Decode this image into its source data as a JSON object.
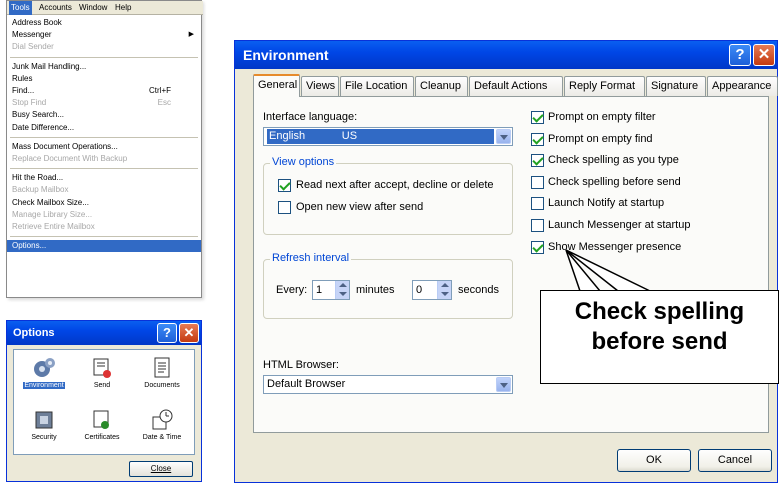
{
  "tools_menu": {
    "menubar": [
      "Tools",
      "Accounts",
      "Window",
      "Help"
    ],
    "items": [
      {
        "label": "Address Book",
        "disabled": false
      },
      {
        "label": "Messenger",
        "disabled": false,
        "submenu": true
      },
      {
        "label": "Dial Sender",
        "disabled": true
      },
      {
        "sep": true
      },
      {
        "label": "Junk Mail Handling...",
        "disabled": false
      },
      {
        "label": "Rules",
        "disabled": false
      },
      {
        "label": "Find...",
        "shortcut": "Ctrl+F",
        "disabled": false
      },
      {
        "label": "Stop Find",
        "shortcut": "Esc",
        "disabled": true
      },
      {
        "label": "Busy Search...",
        "disabled": false
      },
      {
        "label": "Date Difference...",
        "disabled": false
      },
      {
        "sep": true
      },
      {
        "label": "Mass Document Operations...",
        "disabled": false
      },
      {
        "label": "Replace Document With Backup",
        "disabled": true
      },
      {
        "sep": true
      },
      {
        "label": "Hit the Road...",
        "disabled": false
      },
      {
        "label": "Backup Mailbox",
        "disabled": true
      },
      {
        "label": "Check Mailbox Size...",
        "disabled": false
      },
      {
        "label": "Manage Library Size...",
        "disabled": true
      },
      {
        "label": "Retrieve Entire Mailbox",
        "disabled": true
      },
      {
        "sep": true
      },
      {
        "label": "Options...",
        "disabled": false,
        "highlighted": true
      }
    ]
  },
  "options_dialog": {
    "title": "Options",
    "help": "?",
    "close": "✕",
    "icons": [
      {
        "label": "Environment",
        "selected": true,
        "icon": "environment-icon"
      },
      {
        "label": "Send",
        "selected": false,
        "icon": "send-icon"
      },
      {
        "label": "Documents",
        "selected": false,
        "icon": "documents-icon"
      },
      {
        "label": "Security",
        "selected": false,
        "icon": "security-icon"
      },
      {
        "label": "Certificates",
        "selected": false,
        "icon": "certificates-icon"
      },
      {
        "label": "Date & Time",
        "selected": false,
        "icon": "date-time-icon"
      }
    ],
    "close_button": "Close"
  },
  "environment_dialog": {
    "title": "Environment",
    "help": "?",
    "close": "✕",
    "tabs": [
      "General",
      "Views",
      "File Location",
      "Cleanup",
      "Default Actions",
      "Reply Format",
      "Signature",
      "Appearance"
    ],
    "active_tab": "General",
    "interface_language_label": "Interface language:",
    "interface_language_value": "English            US",
    "view_options_title": "View options",
    "view_options": [
      {
        "label": "Read next after accept, decline or delete",
        "checked": true
      },
      {
        "label": "Open new view after send",
        "checked": false
      }
    ],
    "refresh_title": "Refresh interval",
    "refresh": {
      "every_label": "Every:",
      "minutes_value": "1",
      "minutes_label": "minutes",
      "seconds_value": "0",
      "seconds_label": "seconds"
    },
    "html_browser_label": "HTML Browser:",
    "html_browser_value": "Default Browser",
    "checkboxes": [
      {
        "label": "Prompt on empty filter",
        "checked": true
      },
      {
        "label": "Prompt on empty find",
        "checked": true
      },
      {
        "label": "Check spelling as you type",
        "checked": true
      },
      {
        "label": "Check spelling before send",
        "checked": false
      },
      {
        "label": "Launch Notify at startup",
        "checked": false
      },
      {
        "label": "Launch Messenger at startup",
        "checked": false
      },
      {
        "label": "Show Messenger presence",
        "checked": true
      }
    ],
    "ok": "OK",
    "cancel": "Cancel"
  },
  "callout": {
    "line1": "Check spelling",
    "line2": "before send"
  }
}
